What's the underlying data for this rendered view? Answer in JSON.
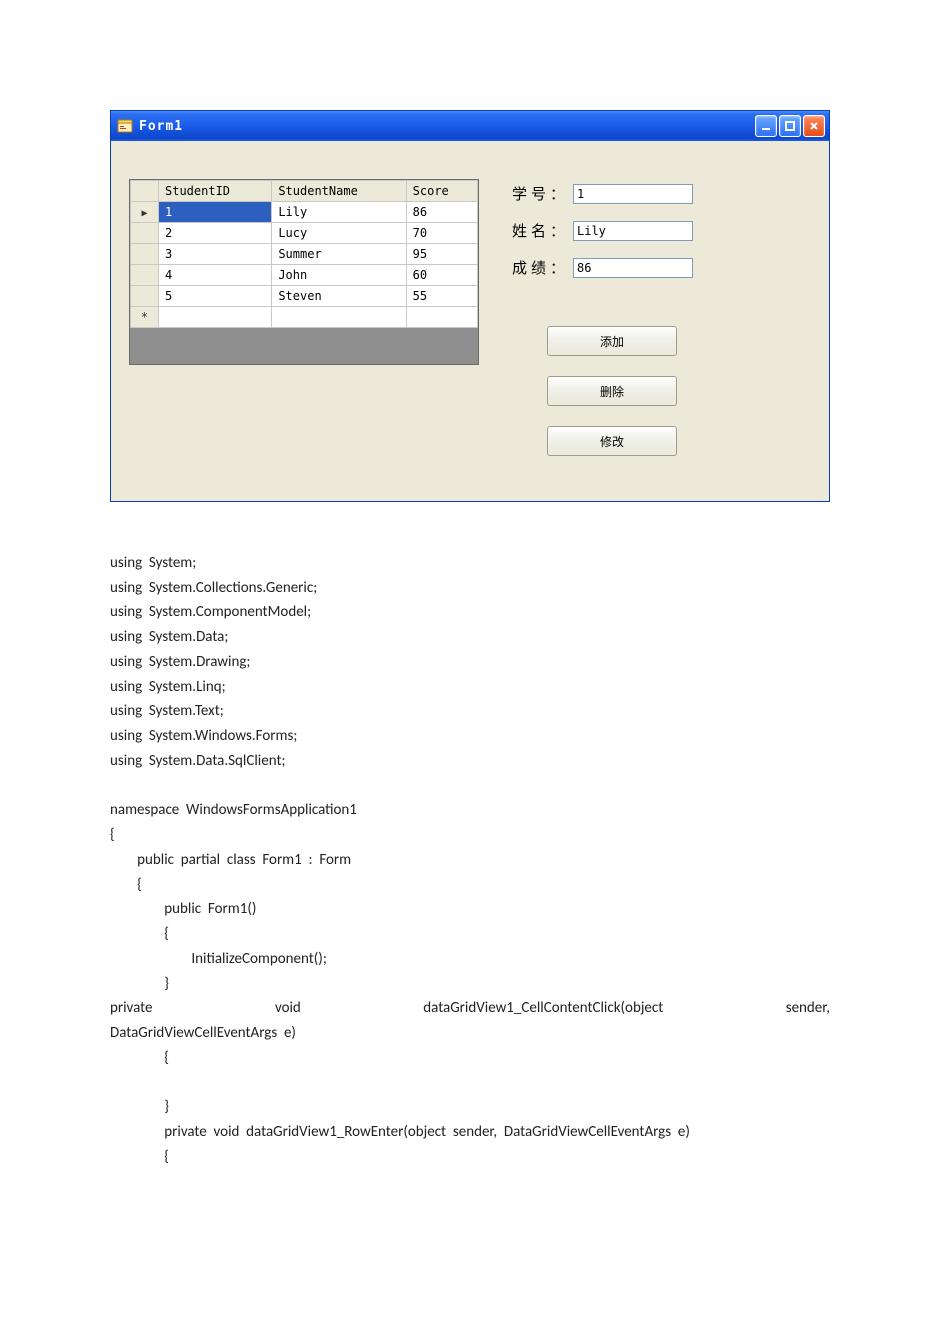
{
  "window": {
    "title": "Form1"
  },
  "grid": {
    "columns": [
      "StudentID",
      "StudentName",
      "Score"
    ],
    "rows": [
      {
        "id": "1",
        "name": "Lily",
        "score": "86",
        "selected": true,
        "current": true
      },
      {
        "id": "2",
        "name": "Lucy",
        "score": "70",
        "selected": false,
        "current": false
      },
      {
        "id": "3",
        "name": "Summer",
        "score": "95",
        "selected": false,
        "current": false
      },
      {
        "id": "4",
        "name": "John",
        "score": "60",
        "selected": false,
        "current": false
      },
      {
        "id": "5",
        "name": "Steven",
        "score": "55",
        "selected": false,
        "current": false
      }
    ],
    "new_row_glyph": "*"
  },
  "form": {
    "labels": {
      "id": "学号：",
      "name": "姓名：",
      "score": "成绩："
    },
    "values": {
      "id": "1",
      "name": "Lily",
      "score": "86"
    }
  },
  "buttons": {
    "add": "添加",
    "delete": "删除",
    "update": "修改"
  },
  "code": {
    "l01": "using  System;",
    "l02": "using  System.Collections.Generic;",
    "l03": "using  System.ComponentModel;",
    "l04": "using  System.Data;",
    "l05": "using  System.Drawing;",
    "l06": "using  System.Linq;",
    "l07": "using  System.Text;",
    "l08": "using  System.Windows.Forms;",
    "l09": "using  System.Data.SqlClient;",
    "l10": "",
    "l11": "namespace  WindowsFormsApplication1",
    "l12": "{",
    "l13": "        public  partial  class  Form1  :  Form",
    "l14": "        {",
    "l15": "                public  Form1()",
    "l16": "                {",
    "l17": "                        InitializeComponent();",
    "l18": "                }",
    "l19a": "                private",
    "l19b": "void",
    "l19c": "dataGridView1_CellContentClick(object",
    "l19d": "sender,",
    "l20": "DataGridViewCellEventArgs  e)",
    "l21": "                {",
    "l22": "",
    "l23": "                }",
    "l24": "                private  void  dataGridView1_RowEnter(object  sender,  DataGridViewCellEventArgs  e)",
    "l25": "                {"
  }
}
